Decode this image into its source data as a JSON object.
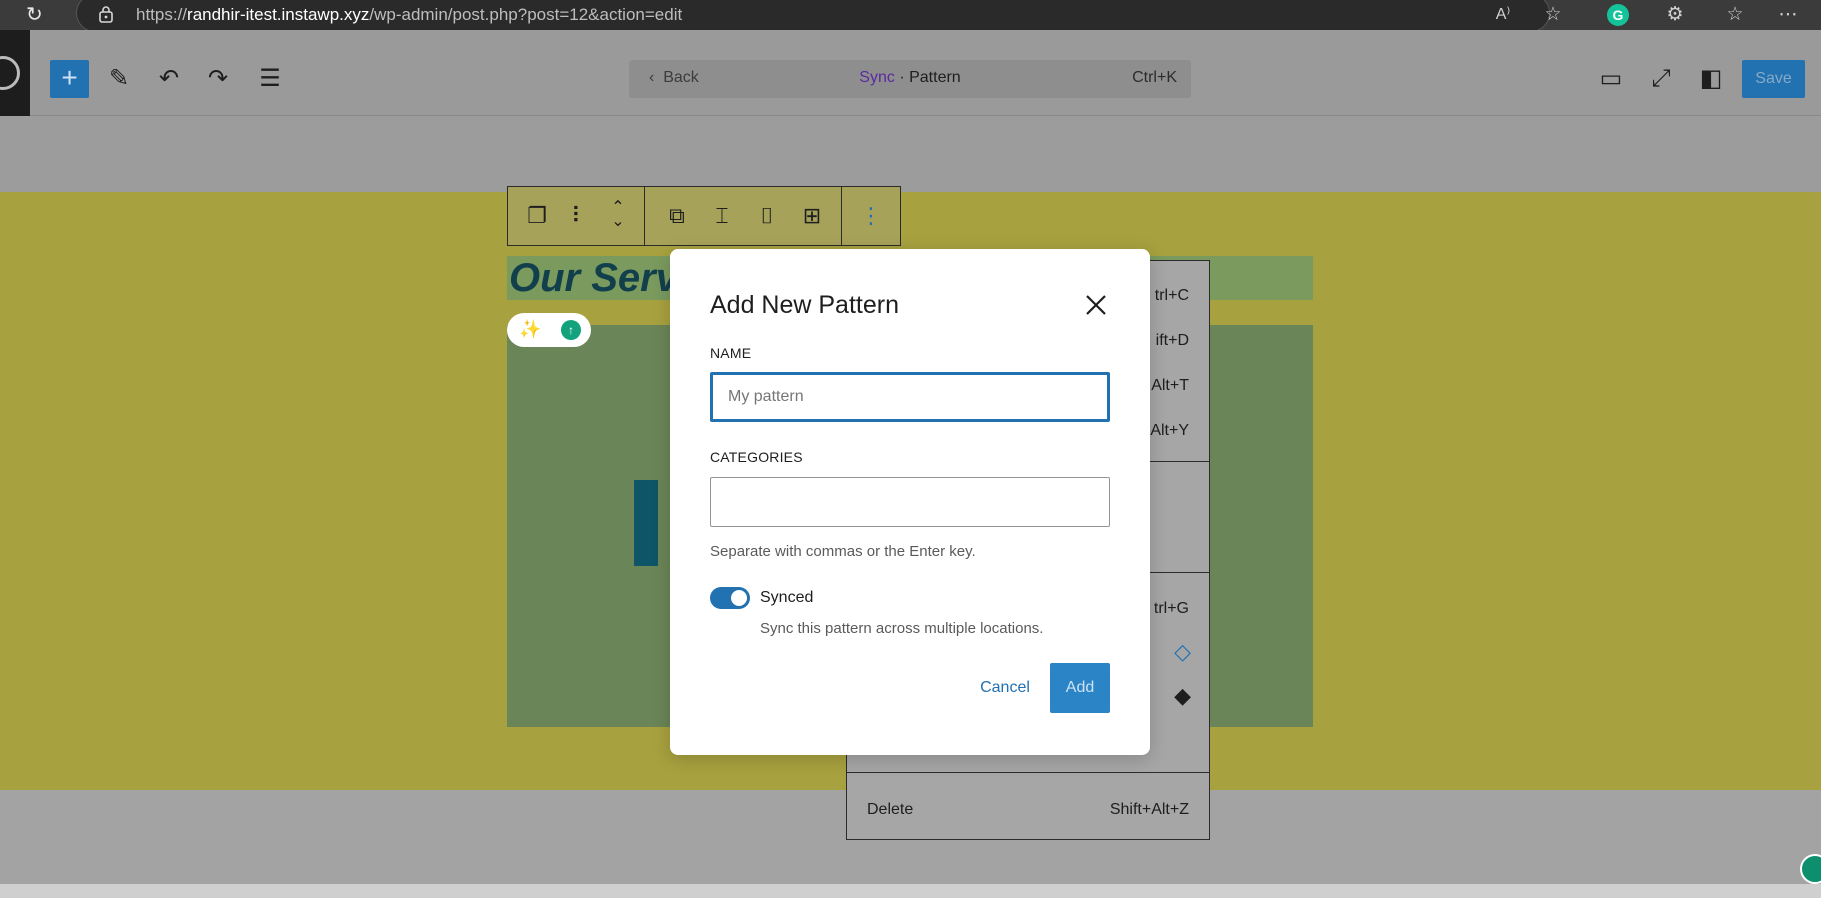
{
  "browser": {
    "url_prefix": "https://",
    "url_host": "randhir-itest.instawp.xyz",
    "url_path": "/wp-admin/post.php?post=12&action=edit",
    "grammarly_letter": "G"
  },
  "editor_toolbar": {
    "add_label": "+",
    "command": {
      "back_label": "Back",
      "sync_label": "Sync",
      "separator": "·",
      "title": "Pattern",
      "shortcut": "Ctrl+K"
    },
    "save_label": "Save"
  },
  "canvas": {
    "heading": "Our Serv",
    "colors": {
      "canvas_bg": "#a8a13f",
      "block_bg": "#6a8557",
      "accent": "#2271b1"
    }
  },
  "dropdown": {
    "shortcuts": [
      "trl+C",
      "ift+D",
      "Alt+T",
      "Alt+Y",
      "trl+G"
    ],
    "delete_label": "Delete",
    "delete_shortcut": "Shift+Alt+Z"
  },
  "modal": {
    "title": "Add New Pattern",
    "name_label": "NAME",
    "name_placeholder": "My pattern",
    "name_value": "",
    "categories_label": "CATEGORIES",
    "categories_value": "",
    "categories_help": "Separate with commas or the Enter key.",
    "synced_label": "Synced",
    "synced_on": true,
    "synced_help": "Sync this pattern across multiple locations.",
    "cancel_label": "Cancel",
    "add_label": "Add"
  }
}
